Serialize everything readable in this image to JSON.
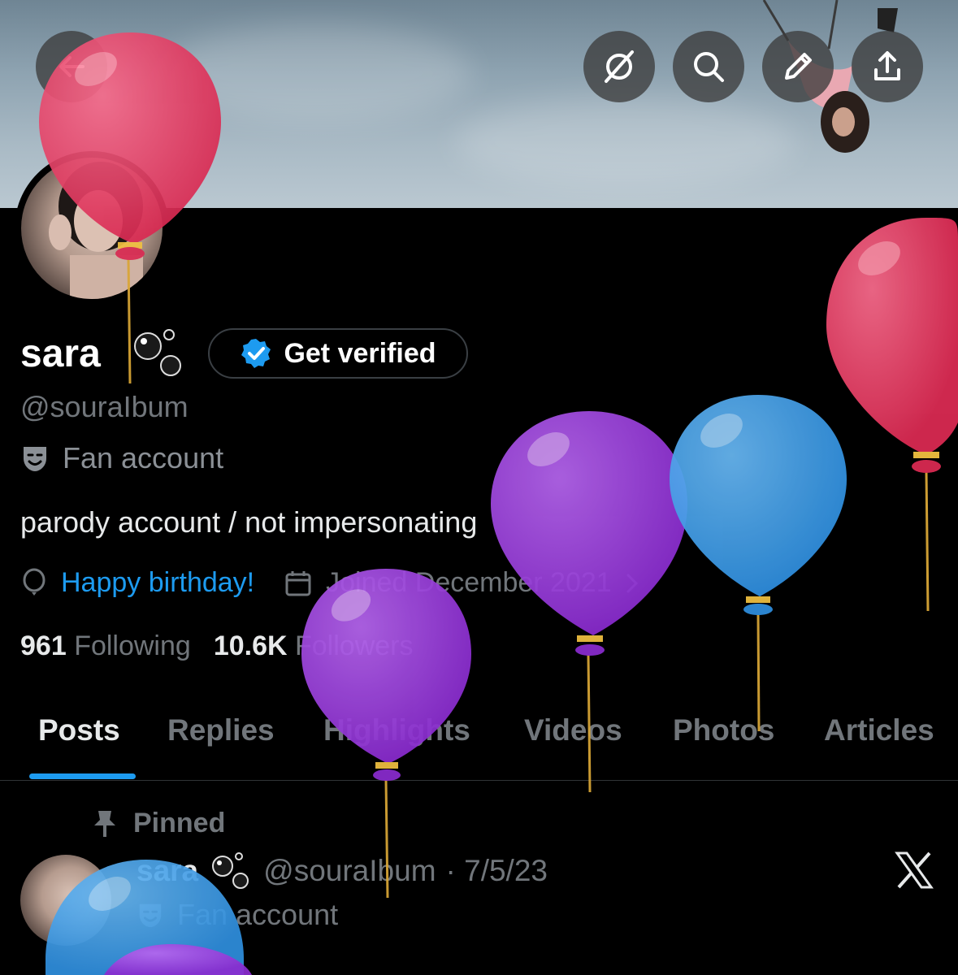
{
  "profile": {
    "name": "sara",
    "get_verified_label": "Get verified",
    "handle": "@souraIbum",
    "category": "Fan account",
    "bio": "parody account / not impersonating",
    "birthday_text": "Happy birthday!",
    "joined_text": "Joined December 2021",
    "following_count": "961",
    "following_label": "Following",
    "followers_count": "10.6K",
    "followers_label": "Followers"
  },
  "tabs": [
    {
      "label": "Posts",
      "active": true
    },
    {
      "label": "Replies",
      "active": false
    },
    {
      "label": "Highlights",
      "active": false
    },
    {
      "label": "Videos",
      "active": false
    },
    {
      "label": "Photos",
      "active": false
    },
    {
      "label": "Articles",
      "active": false
    }
  ],
  "pinned_post": {
    "pinned_label": "Pinned",
    "author_name": "sara",
    "author_handle": "@souraIbum",
    "date": "· 7/5/23",
    "category": "Fan account"
  },
  "header_buttons": [
    "back-icon",
    "grok-icon",
    "search-icon",
    "edit-icon",
    "share-icon"
  ],
  "colors": {
    "accent": "#1d9bf0",
    "background": "#000000",
    "balloon_red": "#e6395f",
    "balloon_purple": "#9b3fd8",
    "balloon_blue": "#3a9bea"
  }
}
